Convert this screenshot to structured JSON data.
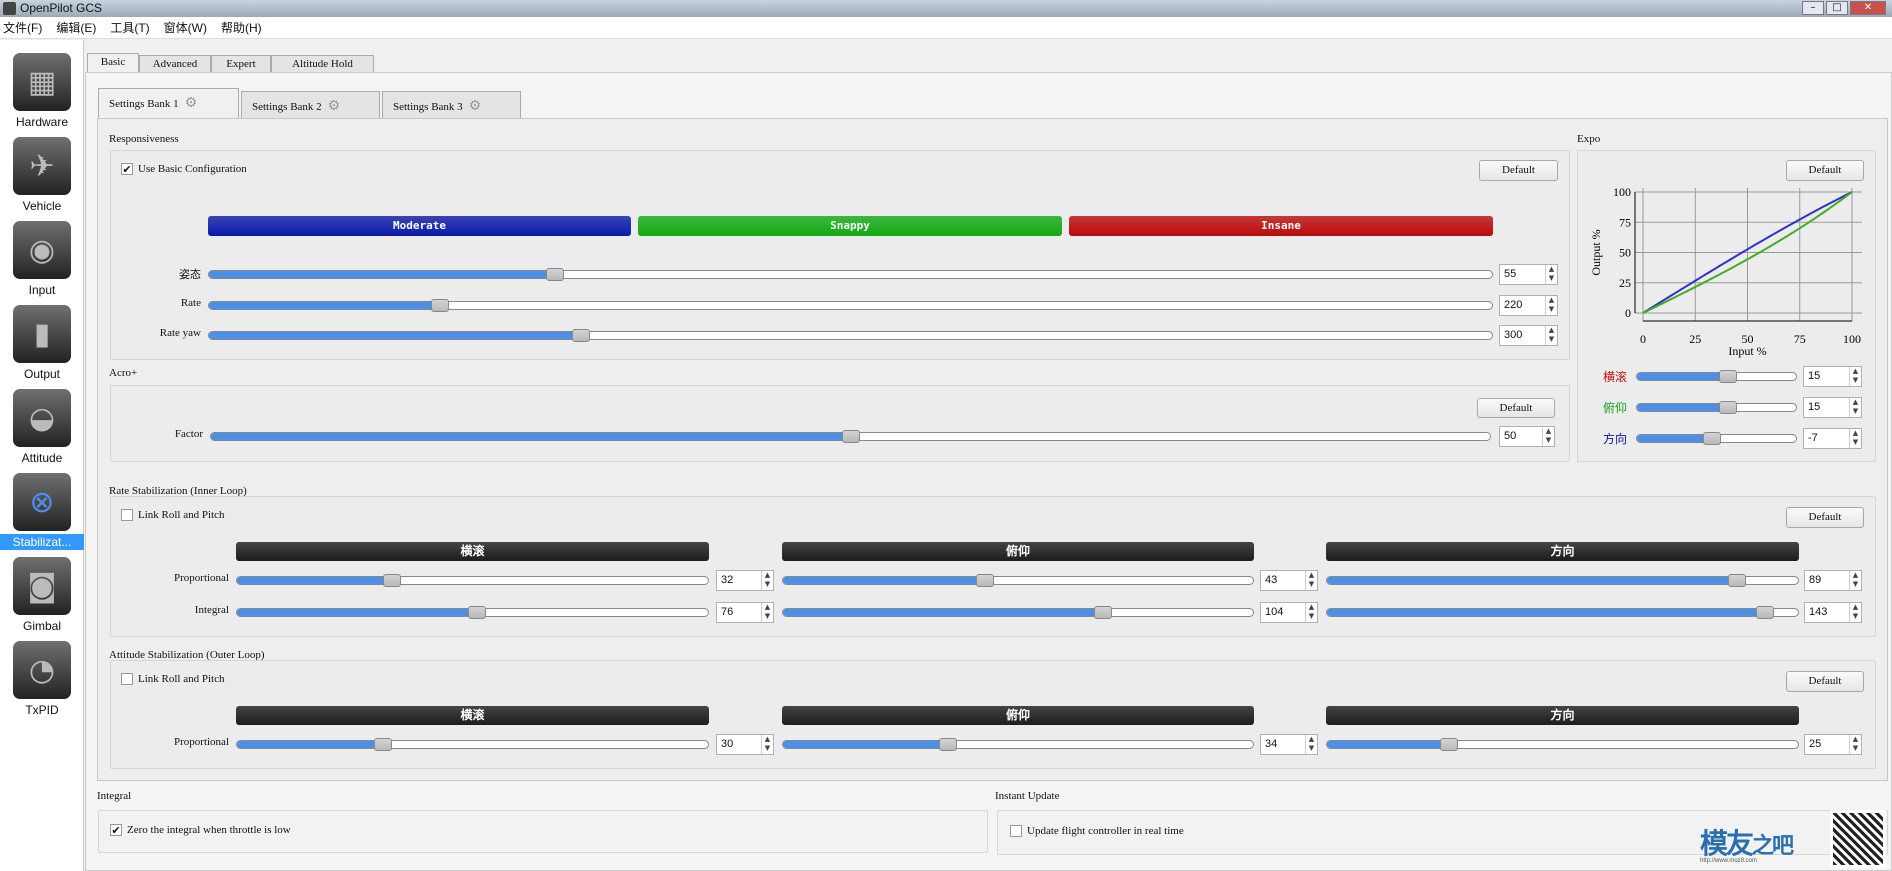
{
  "window": {
    "title": "OpenPilot GCS"
  },
  "menu": [
    "文件(F)",
    "编辑(E)",
    "工具(T)",
    "窗体(W)",
    "帮助(H)"
  ],
  "sidebar": [
    {
      "label": "Hardware",
      "icon": "chip-icon",
      "glyph": "▦"
    },
    {
      "label": "Vehicle",
      "icon": "airplane-icon",
      "glyph": "✈"
    },
    {
      "label": "Input",
      "icon": "transmitter-icon",
      "glyph": "◉"
    },
    {
      "label": "Output",
      "icon": "motor-icon",
      "glyph": "▮"
    },
    {
      "label": "Attitude",
      "icon": "level-icon",
      "glyph": "◒"
    },
    {
      "label": "Stabilizat...",
      "icon": "gyro-icon",
      "glyph": "⊗",
      "active": true
    },
    {
      "label": "Gimbal",
      "icon": "camera-icon",
      "glyph": "◙"
    },
    {
      "label": "TxPID",
      "icon": "meter-icon",
      "glyph": "◔"
    }
  ],
  "tabs": [
    "Basic",
    "Advanced",
    "Expert",
    "Altitude Hold"
  ],
  "bank_tabs": [
    "Settings Bank 1",
    "Settings Bank 2",
    "Settings Bank 3"
  ],
  "responsiveness": {
    "title": "Responsiveness",
    "use_basic": "Use Basic Configuration",
    "use_basic_checked": true,
    "default": "Default",
    "presets": [
      {
        "label": "Moderate",
        "color": "#0a1aa8"
      },
      {
        "label": "Snappy",
        "color": "#12aa12"
      },
      {
        "label": "Insane",
        "color": "#bb0a0a"
      }
    ],
    "sliders": [
      {
        "label": "姿态",
        "value": "55",
        "level": 0.27
      },
      {
        "label": "Rate",
        "value": "220",
        "level": 0.18
      },
      {
        "label": "Rate yaw",
        "value": "300",
        "level": 0.29
      }
    ]
  },
  "acro": {
    "title": "Acro+",
    "default": "Default",
    "slider": {
      "label": "Factor",
      "value": "50",
      "level": 0.5
    }
  },
  "expo": {
    "title": "Expo",
    "default": "Default",
    "chart_data": {
      "type": "line",
      "xlabel": "Input %",
      "ylabel": "Output %",
      "xlim": [
        0,
        100
      ],
      "ylim": [
        0,
        100
      ],
      "xticks": [
        0,
        25,
        50,
        75,
        100
      ],
      "yticks": [
        0,
        25,
        50,
        75,
        100
      ],
      "grid": true,
      "series": [
        {
          "color": "#3030d0",
          "expo": -7
        },
        {
          "color": "#40b020",
          "expo": 15
        }
      ]
    },
    "sliders": [
      {
        "label": "横滚",
        "color": "#cc1010",
        "value": "15",
        "level": 0.57
      },
      {
        "label": "俯仰",
        "color": "#20a020",
        "value": "15",
        "level": 0.57
      },
      {
        "label": "方向",
        "color": "#1010aa",
        "value": "-7",
        "level": 0.47
      }
    ]
  },
  "rate_stab": {
    "title": "Rate Stabilization (Inner Loop)",
    "link": "Link Roll and Pitch",
    "default": "Default",
    "axes": [
      "横滚",
      "俯仰",
      "方向"
    ],
    "rows": [
      {
        "label": "Proportional",
        "cells": [
          {
            "value": "32",
            "level": 0.33
          },
          {
            "value": "43",
            "level": 0.43
          },
          {
            "value": "89",
            "level": 0.87
          }
        ]
      },
      {
        "label": "Integral",
        "cells": [
          {
            "value": "76",
            "level": 0.51
          },
          {
            "value": "104",
            "level": 0.68
          },
          {
            "value": "143",
            "level": 0.93
          }
        ]
      }
    ]
  },
  "att_stab": {
    "title": "Attitude Stabilization (Outer Loop)",
    "link": "Link Roll and Pitch",
    "default": "Default",
    "axes": [
      "横滚",
      "俯仰",
      "方向"
    ],
    "rows": [
      {
        "label": "Proportional",
        "cells": [
          {
            "value": "30",
            "level": 0.31
          },
          {
            "value": "34",
            "level": 0.35
          },
          {
            "value": "25",
            "level": 0.26
          }
        ]
      }
    ]
  },
  "integral": {
    "title": "Integral",
    "checkbox": "Zero the integral when throttle is low",
    "checked": true
  },
  "instant": {
    "title": "Instant Update",
    "checkbox": "Update flight controller in real time",
    "checked": false
  },
  "watermark": {
    "text": "模友之吧",
    "url": "http://www.moz8.com"
  }
}
